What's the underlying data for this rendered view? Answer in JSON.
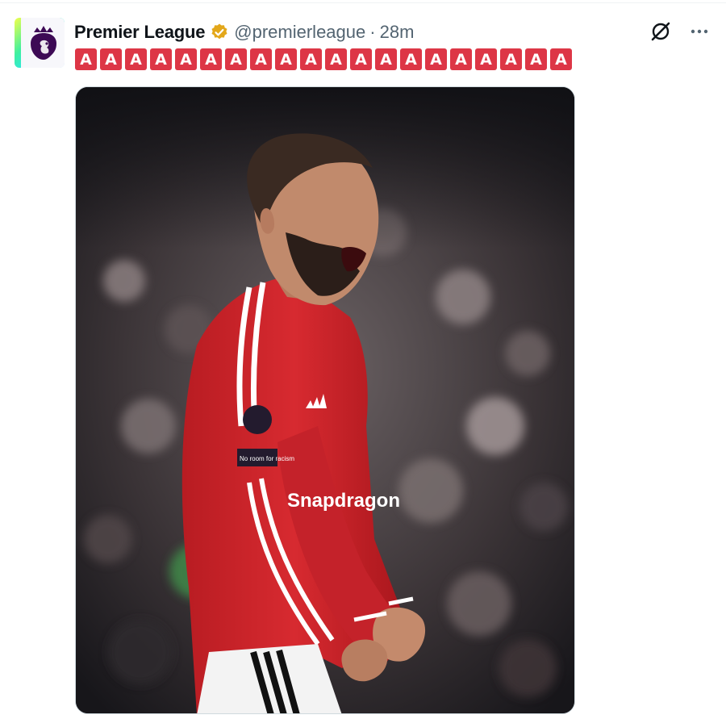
{
  "post": {
    "author": {
      "display_name": "Premier League",
      "handle": "@premierleague",
      "separator": "·",
      "timestamp": "28m",
      "verified_badge": "gold-check-icon",
      "avatar_icon": "premier-league-lion-icon"
    },
    "text_letters": [
      "A",
      "A",
      "A",
      "A",
      "A",
      "A",
      "A",
      "A",
      "A",
      "A",
      "A",
      "A",
      "A",
      "A",
      "A",
      "A",
      "A",
      "A",
      "A",
      "A"
    ],
    "text_style": "red-letter-emoji",
    "actions": [
      {
        "name": "grok-icon"
      },
      {
        "name": "more-icon"
      }
    ],
    "media": {
      "kit_sponsor_text": "Snapdragon",
      "sleeve_badge_text": "No room for racism"
    }
  },
  "colors": {
    "letter_tile": "#dd3646",
    "gold_badge": "#e3a71a",
    "shirt_red": "#d2232a"
  }
}
